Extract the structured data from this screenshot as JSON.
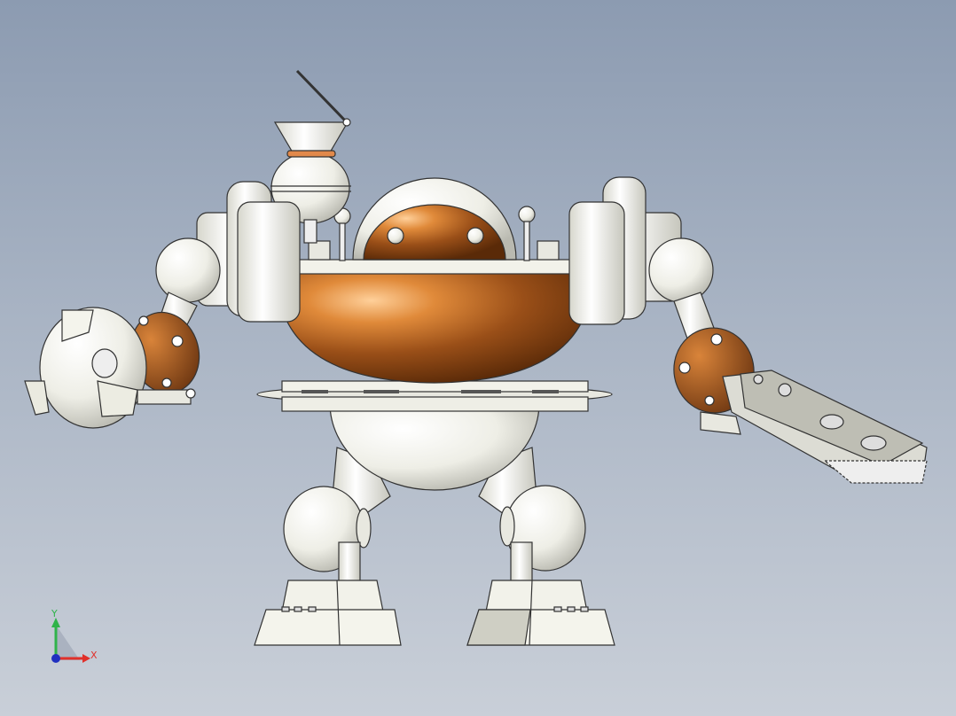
{
  "viewport": {
    "background_top": "#8c9bb1",
    "background_bottom": "#c9cfd8"
  },
  "model": {
    "description_icon": "robot-model",
    "body_color": "#f4f4ee",
    "copper_color": "#a65a1e",
    "copper_highlight": "#f0a050",
    "edge_color": "#333333"
  },
  "triad": {
    "x_label": "X",
    "y_label": "Y",
    "x_color": "#e0302a",
    "y_color": "#2fb34a",
    "z_color": "#2030c0"
  }
}
